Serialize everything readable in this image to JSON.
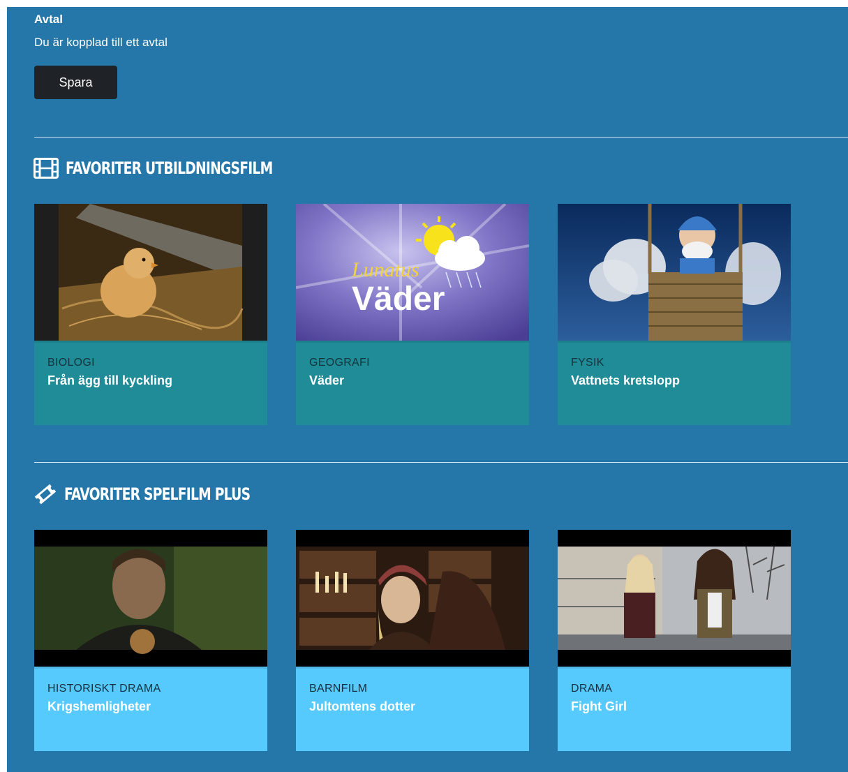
{
  "agreement": {
    "title": "Avtal",
    "status_text": "Du är kopplad till ett avtal",
    "save_label": "Spara"
  },
  "sections": [
    {
      "title": "FAVORITER UTBILDNINGSFILM",
      "icon": "film-icon",
      "cards": [
        {
          "category": "BIOLOGI",
          "title": "Från ägg till kyckling",
          "image": "chick-thumbnail"
        },
        {
          "category": "GEOGRAFI",
          "title": "Väder",
          "image": "weather-thumbnail",
          "image_text": [
            "Lunatus",
            "Väder"
          ]
        },
        {
          "category": "FYSIK",
          "title": "Vattnets kretslopp",
          "image": "balloon-thumbnail"
        }
      ]
    },
    {
      "title": "FAVORITER SPELFILM PLUS",
      "icon": "ticket-icon",
      "cards": [
        {
          "category": "HISTORISKT DRAMA",
          "title": "Krigshemligheter",
          "image": "boy-thumbnail"
        },
        {
          "category": "BARNFILM",
          "title": "Jultomtens dotter",
          "image": "girl-library-thumbnail"
        },
        {
          "category": "DRAMA",
          "title": "Fight Girl",
          "image": "girls-street-thumbnail"
        }
      ]
    }
  ],
  "colors": {
    "panel": "#2577a9",
    "button": "#1f2328",
    "edu_card": "#1f8c98",
    "plus_card": "#56c9fd"
  }
}
